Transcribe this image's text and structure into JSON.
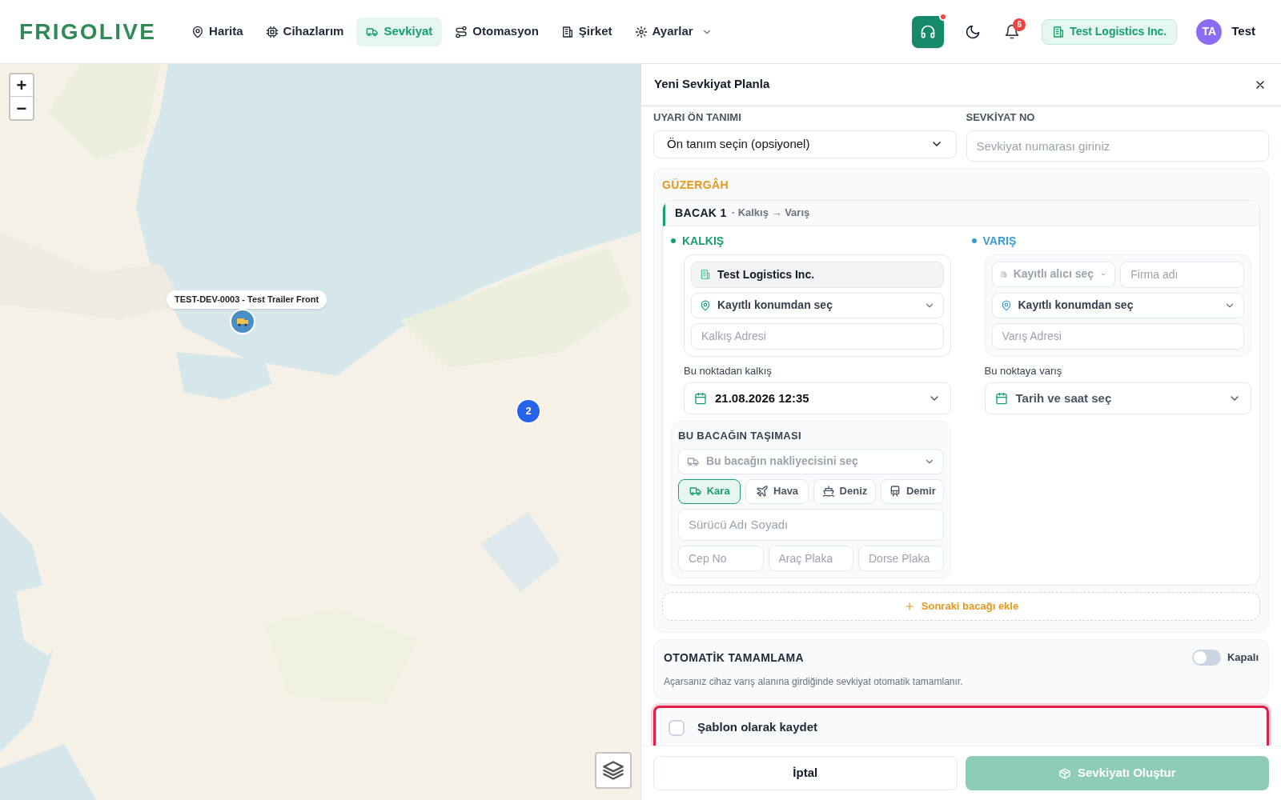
{
  "header": {
    "logo": "FRIGOLIVE",
    "nav": [
      {
        "label": "Harita",
        "selected": false,
        "has_menu": false
      },
      {
        "label": "Cihazlarım",
        "selected": false,
        "has_menu": false
      },
      {
        "label": "Sevkiyat",
        "selected": true,
        "has_menu": false
      },
      {
        "label": "Otomasyon",
        "selected": false,
        "has_menu": false
      },
      {
        "label": "Şirket",
        "selected": false,
        "has_menu": false
      },
      {
        "label": "Ayarlar",
        "selected": false,
        "has_menu": true
      }
    ],
    "support": {
      "alert": true
    },
    "notifications": {
      "count": "6"
    },
    "company": "Test Logistics Inc.",
    "user": {
      "initials": "TA",
      "name": "Test"
    }
  },
  "map": {
    "zoom_in": "+",
    "zoom_out": "−",
    "marker": {
      "label": "TEST-DEV-0003 - Test Trailer Front"
    },
    "cluster": {
      "count": "2"
    }
  },
  "panel": {
    "title": "Yeni Sevkiyat Planla",
    "alert_preset": {
      "label": "UYARI ÖN TANIMI",
      "value": "Ön tanım seçin (opsiyonel)"
    },
    "shipment_no": {
      "label": "SEVKİYAT NO",
      "placeholder": "Sevkiyat numarası giriniz"
    },
    "route": {
      "title": "GÜZERGÂH",
      "legs": [
        {
          "title": "BACAK 1",
          "subtitle": "· Kalkış → Varış",
          "origin": {
            "title": "KALKIŞ",
            "company": "Test Logistics Inc.",
            "location": "Kayıtlı konumdan seç",
            "address_placeholder": "Kalkış Adresi",
            "time_label": "Bu noktadan kalkış",
            "time_value": "21.08.2026 12:35"
          },
          "destination": {
            "title": "VARIŞ",
            "recipient": "Kayıtlı alıcı seç",
            "company_placeholder": "Firma adı",
            "location": "Kayıtlı konumdan seç",
            "address_placeholder": "Varış Adresi",
            "time_label": "Bu noktaya varış",
            "time_placeholder": "Tarih ve saat seç"
          },
          "transport": {
            "title": "BU BACAĞIN TAŞIMASI",
            "carrier": "Bu bacağın nakliyecisini seç",
            "modes": [
              {
                "label": "Kara",
                "selected": true
              },
              {
                "label": "Hava",
                "selected": false
              },
              {
                "label": "Deniz",
                "selected": false
              },
              {
                "label": "Demir",
                "selected": false
              }
            ],
            "driver_placeholder": "Sürücü Adı Soyadı",
            "phone_placeholder": "Cep No",
            "vehicle_placeholder": "Araç Plaka",
            "trailer_placeholder": "Dorse Plaka"
          }
        }
      ],
      "add_leg": "Sonraki bacağı ekle"
    },
    "auto_complete": {
      "title": "OTOMATİK TAMAMLAMA",
      "on": false,
      "state_label": "Kapalı",
      "description": "Açarsanız cihaz varış alanına girdiğinde sevkiyat otomatik tamamlanır."
    },
    "template": {
      "label": "Şablon olarak kaydet",
      "checked": false,
      "highlighted": true
    },
    "buttons": {
      "cancel": "İptal",
      "submit": {
        "label": "Sevkiyatı Oluştur",
        "disabled": true
      }
    }
  }
}
